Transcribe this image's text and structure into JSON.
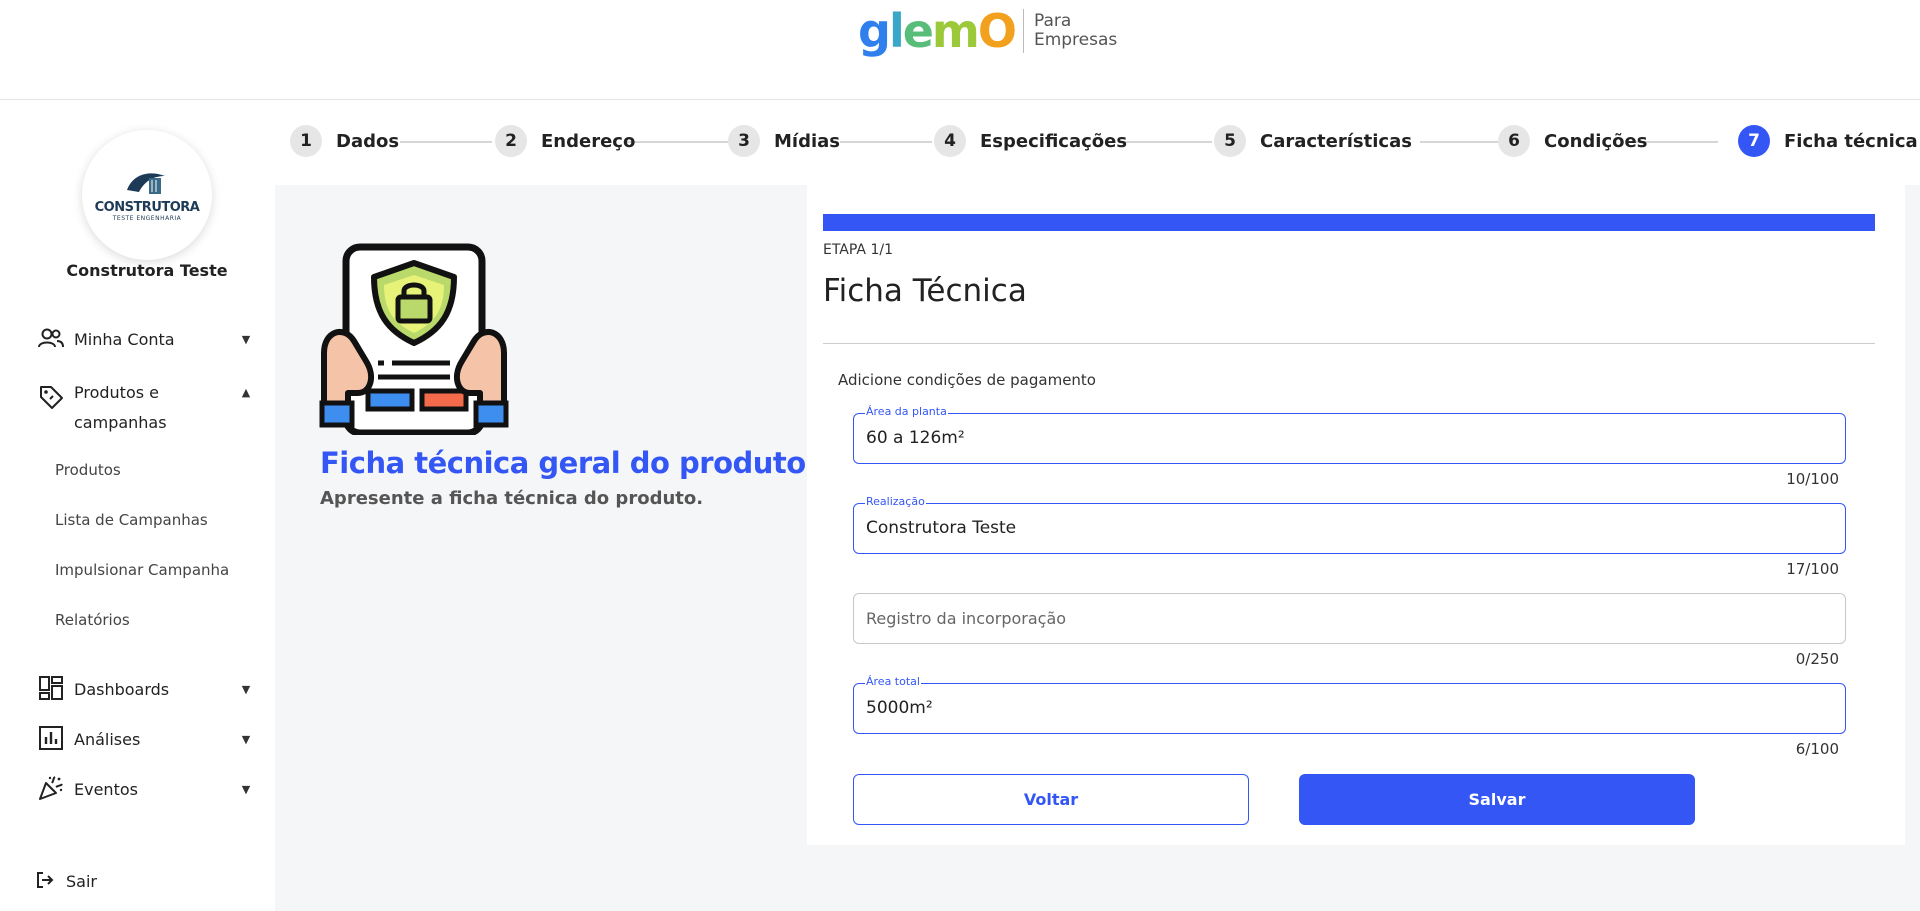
{
  "header": {
    "logo_text": "glemO",
    "logo_sub_1": "Para",
    "logo_sub_2": "Empresas"
  },
  "sidebar": {
    "avatar_brand": "CONSTRUTORA",
    "avatar_brand_sub": "TESTE ENGENHARIA",
    "company_name": "Construtora Teste",
    "items": [
      {
        "label": "Minha Conta",
        "icon": "people-icon",
        "expanded": false
      },
      {
        "label": "Produtos e campanhas",
        "icon": "tag-icon",
        "expanded": true
      },
      {
        "label": "Dashboards",
        "icon": "dashboard-icon",
        "expanded": false
      },
      {
        "label": "Análises",
        "icon": "chart-icon",
        "expanded": false
      },
      {
        "label": "Eventos",
        "icon": "party-icon",
        "expanded": false
      }
    ],
    "sub_items": [
      "Produtos",
      "Lista de Campanhas",
      "Impulsionar Campanha",
      "Relatórios"
    ],
    "logout": "Sair"
  },
  "stepper": {
    "steps": [
      {
        "num": "1",
        "label": "Dados"
      },
      {
        "num": "2",
        "label": "Endereço"
      },
      {
        "num": "3",
        "label": "Mídias"
      },
      {
        "num": "4",
        "label": "Especificações"
      },
      {
        "num": "5",
        "label": "Características"
      },
      {
        "num": "6",
        "label": "Condições"
      },
      {
        "num": "7",
        "label": "Ficha técnica"
      }
    ],
    "active_step": 7
  },
  "info": {
    "title": "Ficha técnica geral do produto",
    "subtitle": "Apresente a ficha técnica do produto."
  },
  "form": {
    "progress_fraction": 1.0,
    "etapa": "ETAPA 1/1",
    "title": "Ficha Técnica",
    "description": "Adicione condições de pagamento",
    "fields": [
      {
        "label": "Área da planta",
        "value": "60 a 126m²",
        "counter": "10/100"
      },
      {
        "label": "Realização",
        "value": "Construtora Teste",
        "counter": "17/100"
      },
      {
        "placeholder": "Registro da incorporação",
        "counter": "0/250"
      },
      {
        "label": "Área total",
        "value": "5000m²",
        "counter": "6/100"
      }
    ],
    "back_label": "Voltar",
    "save_label": "Salvar"
  },
  "colors": {
    "accent": "#3456f5",
    "background": "#f5f6f8"
  }
}
